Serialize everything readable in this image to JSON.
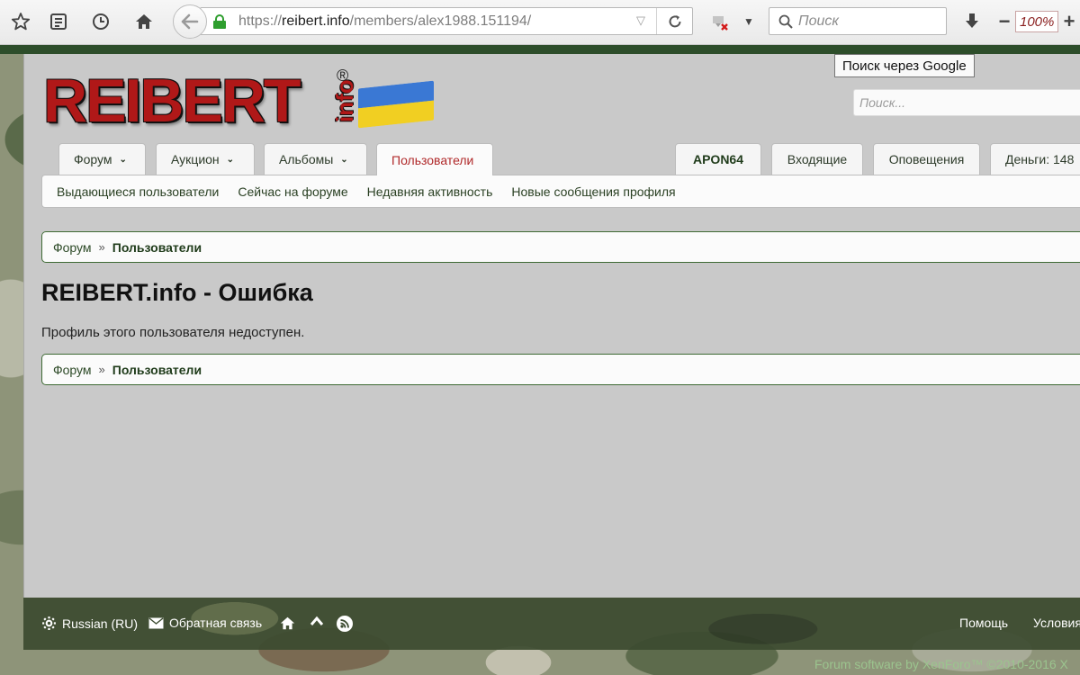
{
  "browser": {
    "url_scheme": "https://",
    "url_host": "reibert.info",
    "url_path": "/members/alex1988.151194/",
    "search_placeholder": "Поиск",
    "zoom": "100%",
    "tooltip": "Поиск через Google"
  },
  "site": {
    "logo_text": "REIBERT",
    "logo_suffix": "info",
    "logo_reg": "®",
    "search_placeholder": "Поиск...",
    "flag_colors": [
      "#3a78d4",
      "#f1cf22"
    ]
  },
  "nav": {
    "tabs": [
      {
        "label": "Форум",
        "has_menu": true
      },
      {
        "label": "Аукцион",
        "has_menu": true
      },
      {
        "label": "Альбомы",
        "has_menu": true
      },
      {
        "label": "Пользователи",
        "has_menu": false,
        "active": true
      }
    ],
    "user_tabs": [
      {
        "label": "APON64"
      },
      {
        "label": "Входящие"
      },
      {
        "label": "Оповещения"
      },
      {
        "label": "Деньги: 148"
      }
    ],
    "subnav": [
      "Выдающиеся пользователи",
      "Сейчас на форуме",
      "Недавняя активность",
      "Новые сообщения профиля"
    ]
  },
  "breadcrumb": {
    "root": "Форум",
    "separator": "»",
    "current": "Пользователи"
  },
  "main": {
    "title": "REIBERT.info - Ошибка",
    "message": "Профиль этого пользователя недоступен."
  },
  "footer": {
    "language": "Russian (RU)",
    "feedback": "Обратная связь",
    "help": "Помощь",
    "terms": "Условия",
    "copyright": "Forum software by XenForo™ ©2010-2016 X"
  },
  "colors": {
    "accent_green": "#1f3b1a",
    "active_tab_red": "#b0292a",
    "logo_red": "#b01818"
  }
}
